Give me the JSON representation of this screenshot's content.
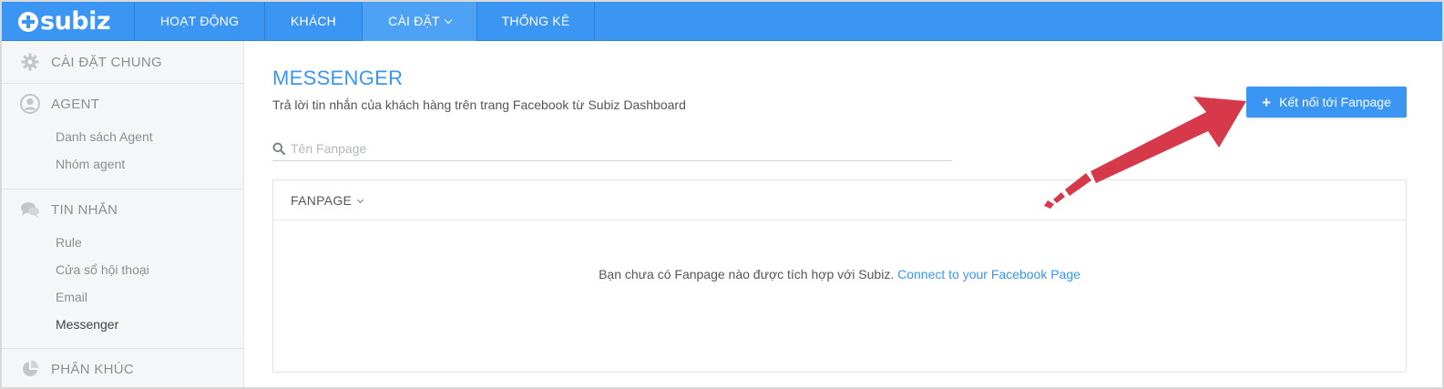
{
  "logo": {
    "text": "subiz"
  },
  "nav": {
    "items": [
      {
        "label": "HOẠT ĐỘNG"
      },
      {
        "label": "KHÁCH"
      },
      {
        "label": "CÀI ĐẶT",
        "active": true
      },
      {
        "label": "THỐNG KÊ"
      }
    ]
  },
  "sidebar": {
    "general": {
      "label": "CÀI ĐẶT CHUNG",
      "icon": "gear-icon"
    },
    "agent": {
      "label": "AGENT",
      "icon": "user-icon",
      "links": [
        "Danh sách Agent",
        "Nhóm agent"
      ]
    },
    "messages": {
      "label": "TIN NHẮN",
      "icon": "chat-bubbles-icon",
      "links": [
        "Rule",
        "Cửa sổ hội thoại",
        "Email",
        "Messenger"
      ],
      "active": "Messenger"
    },
    "segments": {
      "label": "PHÂN KHÚC",
      "icon": "pie-chart-icon"
    }
  },
  "main": {
    "title": "MESSENGER",
    "subtitle": "Trả lời tin nhắn của khách hàng trên trang Facebook từ Subiz Dashboard",
    "connect_button": "Kết nối tới Fanpage",
    "search_placeholder": "Tên Fanpage",
    "panel": {
      "header": "FANPAGE",
      "empty_text": "Bạn chưa có Fanpage nào được tích hợp với Subiz.",
      "empty_link": "Connect to your Facebook Page"
    }
  },
  "colors": {
    "brand": "#3b95f2",
    "annotation_arrow": "#d63a4a"
  }
}
